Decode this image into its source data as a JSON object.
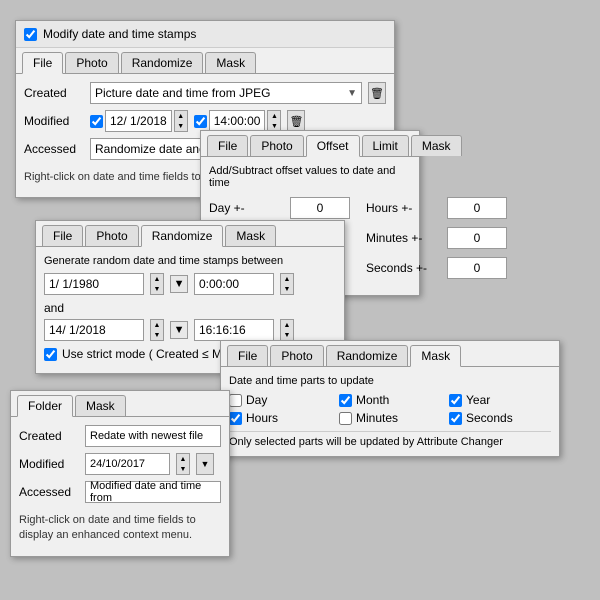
{
  "panel1": {
    "header_checkbox_label": "Modify date and time stamps",
    "tabs": [
      "File",
      "Photo",
      "Randomize",
      "Mask"
    ],
    "active_tab": "File",
    "rows": {
      "created_label": "Created",
      "created_value": "Picture date and time from JPEG",
      "modified_label": "Modified",
      "modified_date": "12/ 1/2018",
      "modified_time": "14:00:00",
      "accessed_label": "Accessed",
      "accessed_value": "Randomize date and time"
    },
    "info_text": "Right-click on date and time fields to display an enhanced context menu."
  },
  "panel2": {
    "tabs": [
      "File",
      "Photo",
      "Offset",
      "Limit",
      "Mask"
    ],
    "active_tab": "Offset",
    "title": "Add/Subtract offset values to date and time",
    "day_label": "Day +-",
    "day_value": "0",
    "hours_label": "Hours +-",
    "hours_value": "0",
    "minutes_label": "Minutes +-",
    "minutes_value": "0",
    "seconds_label": "Seconds +-",
    "seconds_value": "0"
  },
  "panel3": {
    "tabs": [
      "File",
      "Photo",
      "Randomize",
      "Mask"
    ],
    "active_tab": "Randomize",
    "title": "Generate random date and time stamps between",
    "from_date": "1/ 1/1980",
    "from_time": "0:00:00",
    "and_label": "and",
    "to_date": "14/ 1/2018",
    "to_time": "16:16:16",
    "strict_mode_label": "Use strict mode ( Created ≤ Modified ≤ Accessed )"
  },
  "panel4": {
    "tabs": [
      "File",
      "Photo",
      "Randomize",
      "Mask"
    ],
    "active_tab": "Mask",
    "title": "Date and time parts to update",
    "items": [
      {
        "label": "Day",
        "checked": false
      },
      {
        "label": "Month",
        "checked": true
      },
      {
        "label": "Year",
        "checked": true
      },
      {
        "label": "Hours",
        "checked": true
      },
      {
        "label": "Minutes",
        "checked": false
      },
      {
        "label": "Seconds",
        "checked": true
      }
    ],
    "info_text": "Only selected parts will be updated by Attribute Changer"
  },
  "panel5": {
    "tabs": [
      "Folder",
      "Mask"
    ],
    "active_tab": "Folder",
    "rows": {
      "created_label": "Created",
      "created_value": "Redate with newest file",
      "modified_label": "Modified",
      "modified_date": "24/10/2017",
      "accessed_label": "Accessed",
      "accessed_value": "Modified date and time from"
    },
    "info_text": "Right-click on date and time fields to display an enhanced context menu."
  },
  "icons": {
    "dropdown_arrow": "▼",
    "spin_up": "▲",
    "spin_down": "▼",
    "calendar": "📅",
    "trash": "🗑"
  }
}
